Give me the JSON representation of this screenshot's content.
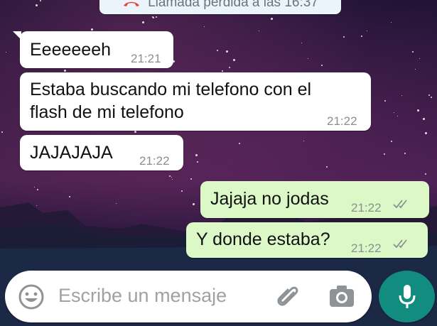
{
  "system_message": {
    "text": "Llamada perdida a las 16:37",
    "icon": "missed-call-icon"
  },
  "messages": [
    {
      "direction": "in",
      "lines": [
        "Eeeeeeeh"
      ],
      "time": "21:21"
    },
    {
      "direction": "in",
      "lines": [
        "Estaba buscando mi telefono con el",
        "flash de mi telefono"
      ],
      "time": "21:22"
    },
    {
      "direction": "in",
      "lines": [
        "JAJAJAJA"
      ],
      "time": "21:22"
    },
    {
      "direction": "out",
      "lines": [
        "Jajaja no jodas"
      ],
      "time": "21:22",
      "status": "read-ticks"
    },
    {
      "direction": "out",
      "lines": [
        "Y donde estaba?"
      ],
      "time": "21:22",
      "status": "read-ticks"
    }
  ],
  "composer": {
    "placeholder": "Escribe un mensaje",
    "emoji_icon": "emoji-icon",
    "attach_icon": "paperclip-icon",
    "camera_icon": "camera-icon",
    "mic_icon": "microphone-icon"
  },
  "colors": {
    "incoming_bubble": "#ffffff",
    "outgoing_bubble": "#dcf8c6",
    "mic_button": "#128c7e",
    "missed_call": "#e0433a",
    "ticks": "#8a8f93"
  }
}
